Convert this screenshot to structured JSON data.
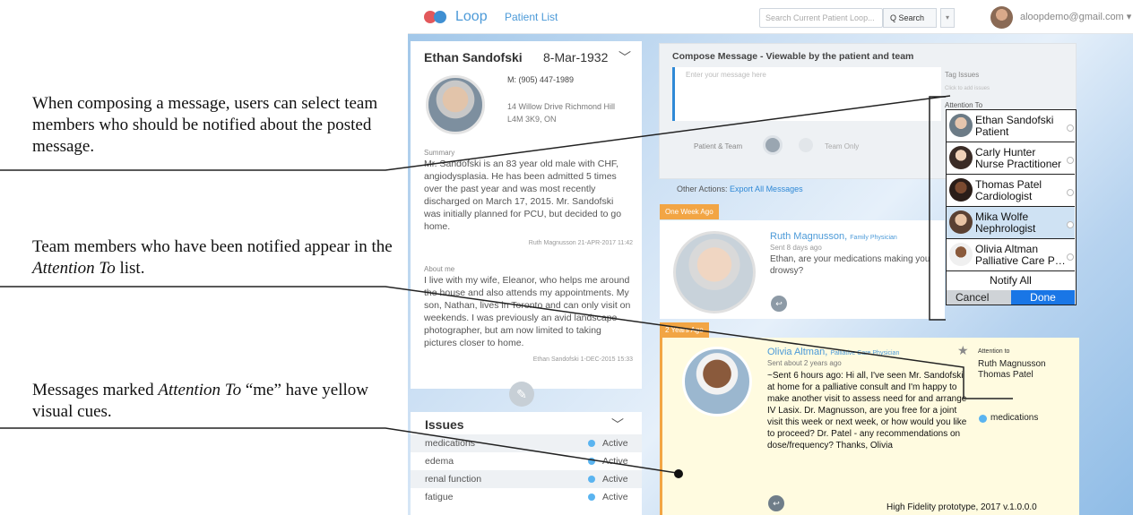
{
  "captions": {
    "c1": "When composing a message, users can select team members who should be notified about the posted message.",
    "c2_pre": "Team members who have been notified appear in the ",
    "c2_em": "Attention To",
    "c2_post": " list.",
    "c3_pre": "Messages marked ",
    "c3_em": "Attention To",
    "c3_post": " “me” have yellow visual cues."
  },
  "topbar": {
    "logo": "Loop",
    "nav": "Patient List",
    "search_placeholder": "Search Current Patient Loop...",
    "search_button": "Q Search",
    "search_dropdown": "▾",
    "user_email": "aloopdemo@gmail.com ▾"
  },
  "patient": {
    "name": "Ethan Sandofski",
    "dob": "8-Mar-1932",
    "chevron": "﹀",
    "phone": "M: (905) 447-1989",
    "address": "14 Willow Drive Richmond Hill L4M 3K9, ON",
    "summary_label": "Summary",
    "summary": "Mr. Sandofski is an 83 year old male with CHF, angiodysplasia. He has been admitted 5 times over the past year and was most recently discharged on March 17, 2015. Mr. Sandofski was initially planned for PCU, but decided to go home.",
    "summary_sign": "Ruth Magnusson 21-APR-2017 11:42",
    "about_label": "About me",
    "about": "I live with my wife, Eleanor, who helps me around the house and also attends my appointments. My son, Nathan, lives in Toronto and can only visit on weekends. I was previously an avid landscape photographer, but am now limited to taking pictures closer to home.",
    "about_sign": "Ethan Sandofski 1-DEC-2015 15:33",
    "edit_icon": "✎"
  },
  "issues": {
    "title": "Issues",
    "chevron": "﹀",
    "rows": [
      {
        "name": "medications",
        "status": "Active"
      },
      {
        "name": "edema",
        "status": "Active"
      },
      {
        "name": "renal function",
        "status": "Active"
      },
      {
        "name": "fatigue",
        "status": "Active"
      }
    ]
  },
  "compose": {
    "title": "Compose Message - Viewable by the patient and team",
    "placeholder": "Enter your message here",
    "audience_left": "Patient & Team",
    "audience_right": "Team Only",
    "tag_issues_label": "Tag Issues",
    "tag_issues_placeholder": "Click to add issues",
    "attention_label": "Attention To"
  },
  "picker": {
    "members": [
      {
        "name": "Ethan Sandofski",
        "role": "Patient"
      },
      {
        "name": "Carly Hunter",
        "role": "Nurse Practitioner"
      },
      {
        "name": "Thomas Patel",
        "role": "Cardiologist"
      },
      {
        "name": "Mika Wolfe",
        "role": "Nephrologist"
      },
      {
        "name": "Olivia Altman",
        "role": "Palliative Care Physician"
      }
    ],
    "notify_all": "Notify All",
    "cancel": "Cancel",
    "done": "Done"
  },
  "other_actions": {
    "label": "Other Actions:",
    "link": "Export All Messages"
  },
  "feed": {
    "badge_week": "One Week Ago",
    "badge_years": "2 Years Ago",
    "ruth": {
      "name": "Ruth Magnusson,",
      "role": "Family Physician",
      "time": "Sent 8 days ago",
      "text": "Ethan, are your medications making you drowsy?"
    },
    "olivia": {
      "name": "Olivia Altman,",
      "role": "Palliative Care Physician",
      "time": "Sent about 2 years ago",
      "text": "~Sent 6 hours ago: Hi all, I've seen Mr. Sandofski at home for a palliative consult and I'm happy to make another visit to assess need for and arrange IV Lasix. Dr. Magnusson, are you free for a joint visit this week or next week, or how would you like to proceed? Dr. Patel - any recommendations on dose/frequency? Thanks, Olivia",
      "star": "★",
      "attention_label": "Attention to",
      "attention": [
        "Ruth Magnusson",
        "Thomas Patel"
      ],
      "tag": "medications"
    },
    "reply_icon": "↩"
  },
  "footer": "High Fidelity prototype, 2017 v.1.0.0.0",
  "colors": {
    "accent": "#4c9ad8",
    "badge": "#f2a544",
    "highlight": "#fffbe0",
    "done": "#1976e6"
  }
}
